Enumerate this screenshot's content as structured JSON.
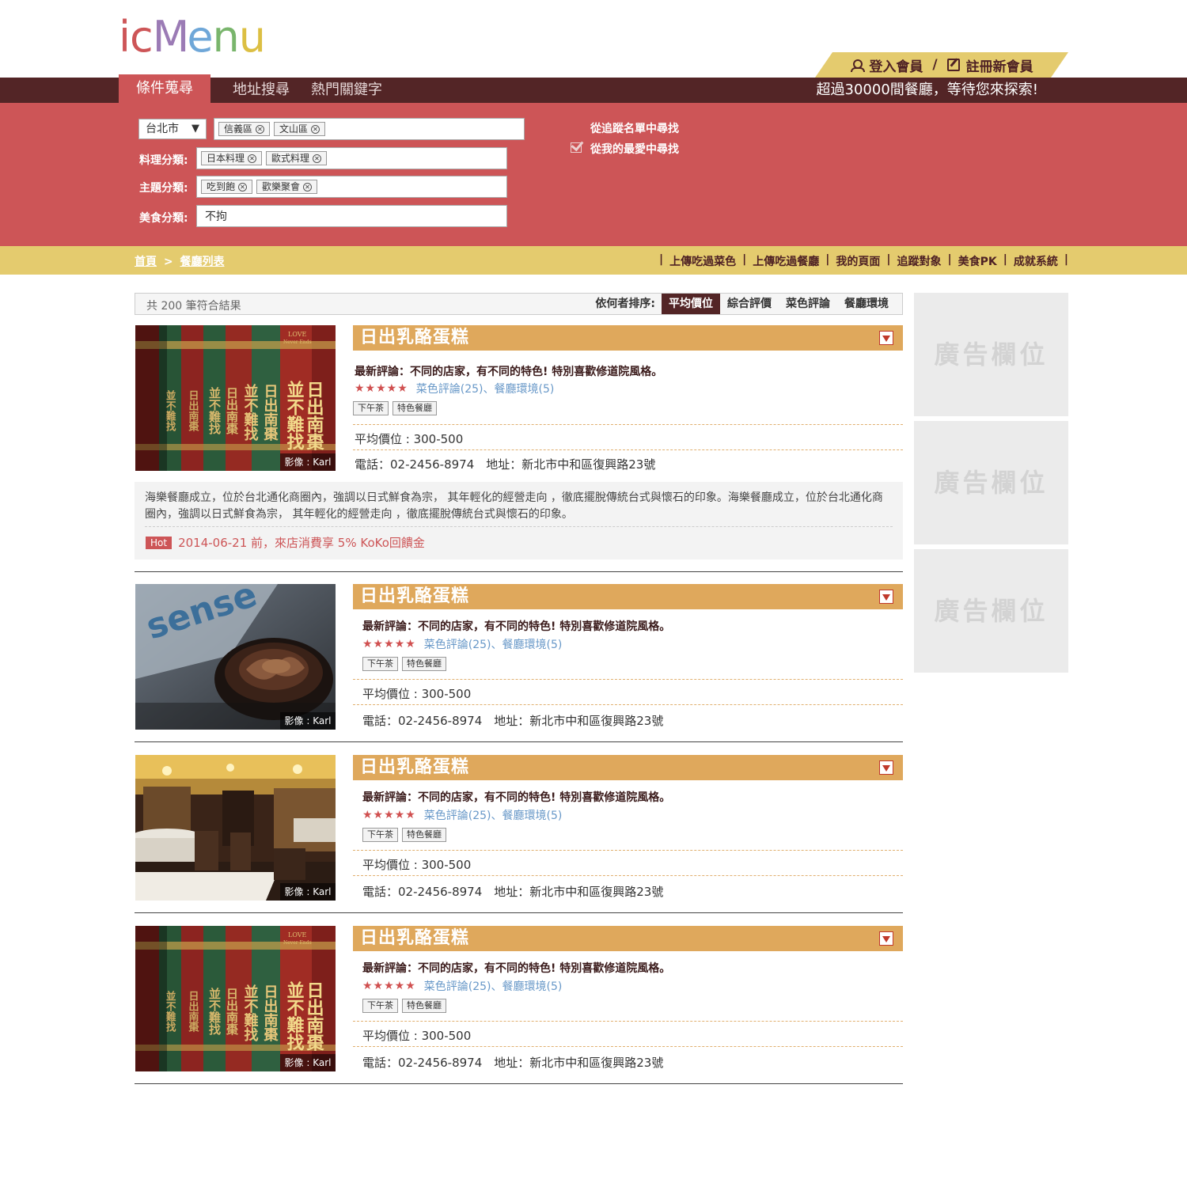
{
  "logo": {
    "letters": [
      "i",
      "c",
      "M",
      "e",
      "n",
      "u"
    ],
    "colors": [
      "#cd5557",
      "#cd5557",
      "#9b7bb5",
      "#6fa7d8",
      "#79b56c",
      "#dcbf43"
    ]
  },
  "member": {
    "login": "登入會員",
    "slash": "/",
    "register": "註冊新會員"
  },
  "tabs": [
    "條件蒐尋",
    "地址搜尋",
    "熱門關鍵字"
  ],
  "tagline": "超過30000間餐廳，等待您來探索!",
  "search": {
    "city": "台北市",
    "city_arrow": "▼",
    "districts": [
      "信義區",
      "文山區"
    ],
    "cuisine_label": "料理分類:",
    "cuisines": [
      "日本料理",
      "歐式料理"
    ],
    "theme_label": "主題分類:",
    "themes": [
      "吃到飽",
      "歡樂聚會"
    ],
    "food_label": "美食分類:",
    "food_value": "不拘",
    "option_tracked": "從追蹤名單中尋找",
    "option_favorite": "從我的最愛中尋找"
  },
  "breadcrumb": {
    "home": "首頁",
    "sep": ">",
    "current": "餐廳列表"
  },
  "quick_links": [
    "上傳吃過菜色",
    "上傳吃過餐廳",
    "我的頁面",
    "追蹤對象",
    "美食PK",
    "成就系統"
  ],
  "results": {
    "count": "共 200 筆符合結果",
    "sort_label": "依何者排序:",
    "sort_options": [
      "平均價位",
      "綜合評價",
      "菜色評論",
      "餐廳環境"
    ],
    "sort_active": "平均價位"
  },
  "cards": [
    {
      "name": "日出乳酪蛋糕",
      "review": "最新評論：不同的店家，有不同的特色! 特別喜歡修道院風格。",
      "stars": "★★★★★",
      "rating_links": "菜色評論(25)、餐廳環境(5)",
      "tags": [
        "下午茶",
        "特色餐廳"
      ],
      "price": "平均價位 : 300-500",
      "contact": "電話：02-2456-8974　地址：新北市中和區復興路23號",
      "credit": "影像 : Karl",
      "image": "books",
      "desc": "海樂餐廳成立，位於台北通化商圈內，強調以日式鮮食為宗， 其年輕化的經營走向 ，徹底擺脫傳統台式與懷石的印象。海樂餐廳成立，位於台北通化商圈內，強調以日式鮮食為宗， 其年輕化的經營走向 ，徹底擺脫傳統台式與懷石的印象。",
      "hot": "Hot",
      "promo": "2014-06-21 前，來店消費享 5% KoKo回饋金"
    },
    {
      "name": "日出乳酪蛋糕",
      "review": "最新評論：不同的店家，有不同的特色! 特別喜歡修道院風格。",
      "stars": "★★★★★",
      "rating_links": "菜色評論(25)、餐廳環境(5)",
      "tags": [
        "下午茶",
        "特色餐廳"
      ],
      "price": "平均價位 : 300-500",
      "contact": "電話：02-2456-8974　地址：新北市中和區復興路23號",
      "credit": "影像 : Karl",
      "image": "coffee",
      "magazine_text": "sense"
    },
    {
      "name": "日出乳酪蛋糕",
      "review": "最新評論：不同的店家，有不同的特色! 特別喜歡修道院風格。",
      "stars": "★★★★★",
      "rating_links": "菜色評論(25)、餐廳環境(5)",
      "tags": [
        "下午茶",
        "特色餐廳"
      ],
      "price": "平均價位 : 300-500",
      "contact": "電話：02-2456-8974　地址：新北市中和區復興路23號",
      "credit": "影像 : Karl",
      "image": "restaurant"
    },
    {
      "name": "日出乳酪蛋糕",
      "review": "最新評論：不同的店家，有不同的特色! 特別喜歡修道院風格。",
      "stars": "★★★★★",
      "rating_links": "菜色評論(25)、餐廳環境(5)",
      "tags": [
        "下午茶",
        "特色餐廳"
      ],
      "price": "平均價位 : 300-500",
      "contact": "電話：02-2456-8974　地址：新北市中和區復興路23號",
      "credit": "影像 : Karl",
      "image": "books"
    }
  ],
  "book_spines": {
    "a": "日出南棗",
    "b": "並不難找",
    "top": "LOVE",
    "sub": "Never Ends"
  },
  "ads": [
    "廣告欄位",
    "廣告欄位",
    "廣告欄位"
  ],
  "colors": {
    "dark": "#532526",
    "red": "#cd5557",
    "gold": "#e4cb6e",
    "title": "#dfa85c",
    "link": "#6898c8"
  }
}
